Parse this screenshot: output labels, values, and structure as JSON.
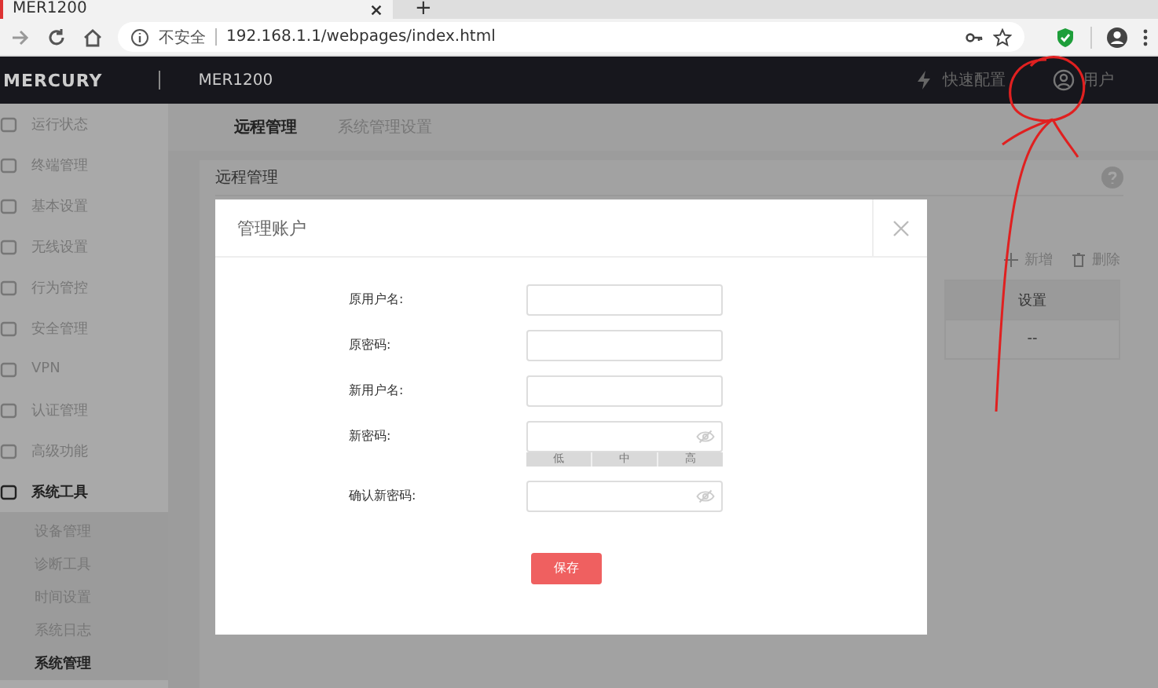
{
  "browser": {
    "tab_title": "MER1200",
    "new_tab": "+",
    "security_label": "不安全",
    "url": "192.168.1.1/webpages/index.html"
  },
  "header": {
    "logo": "MERCURY",
    "product": "MER1200",
    "quick_setup": "快速配置",
    "user": "用户"
  },
  "sidebar": {
    "items": [
      {
        "label": "运行状态",
        "expanded": false
      },
      {
        "label": "终端管理",
        "expanded": false
      },
      {
        "label": "基本设置",
        "expanded": false
      },
      {
        "label": "无线设置",
        "expanded": false
      },
      {
        "label": "行为管控",
        "expanded": false
      },
      {
        "label": "安全管理",
        "expanded": false
      },
      {
        "label": "VPN",
        "expanded": false
      },
      {
        "label": "认证管理",
        "expanded": false
      },
      {
        "label": "高级功能",
        "expanded": false
      },
      {
        "label": "系统工具",
        "expanded": true,
        "children": [
          {
            "label": "设备管理",
            "selected": false
          },
          {
            "label": "诊断工具",
            "selected": false
          },
          {
            "label": "时间设置",
            "selected": false
          },
          {
            "label": "系统日志",
            "selected": false
          },
          {
            "label": "系统管理",
            "selected": true
          }
        ]
      }
    ]
  },
  "tabs": [
    {
      "label": "远程管理",
      "selected": true
    },
    {
      "label": "系统管理设置",
      "selected": false
    }
  ],
  "section": {
    "title": "远程管理"
  },
  "toolbar": [
    {
      "kind": "add",
      "label": "新增"
    },
    {
      "kind": "delete",
      "label": "删除"
    }
  ],
  "table": {
    "columns": [
      "设置"
    ],
    "rows": [
      [
        "--"
      ]
    ]
  },
  "modal": {
    "title": "管理账户",
    "fields": [
      {
        "label": "原用户名:",
        "kind": "text"
      },
      {
        "label": "原密码:",
        "kind": "text"
      },
      {
        "label": "新用户名:",
        "kind": "text"
      },
      {
        "label": "新密码:",
        "kind": "password",
        "strength": [
          "低",
          "中",
          "高"
        ]
      },
      {
        "label": "确认新密码:",
        "kind": "password"
      }
    ],
    "save": "保存"
  }
}
